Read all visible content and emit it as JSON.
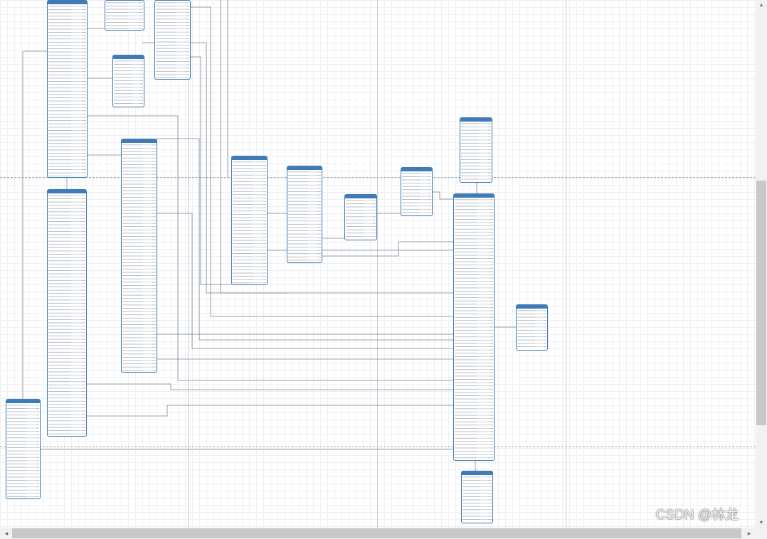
{
  "watermark": "CSDN @林龙",
  "colors": {
    "table_header": "#3f7bb8",
    "table_border": "#3f7bb8",
    "link": "#7d8894",
    "grid": "#eef0f3"
  },
  "icons": {
    "scroll_up": "chevron-up-icon",
    "scroll_down": "chevron-down-icon",
    "scroll_left": "chevron-left-icon",
    "scroll_right": "chevron-right-icon"
  },
  "tables": [
    {
      "id": "t1"
    },
    {
      "id": "t2"
    },
    {
      "id": "t3"
    },
    {
      "id": "t4"
    },
    {
      "id": "t5"
    },
    {
      "id": "t6"
    },
    {
      "id": "t7"
    },
    {
      "id": "t8"
    },
    {
      "id": "t9"
    },
    {
      "id": "t10"
    },
    {
      "id": "t11"
    },
    {
      "id": "t12"
    },
    {
      "id": "t13"
    },
    {
      "id": "t14"
    },
    {
      "id": "t15"
    },
    {
      "id": "t16"
    },
    {
      "id": "t17"
    }
  ]
}
